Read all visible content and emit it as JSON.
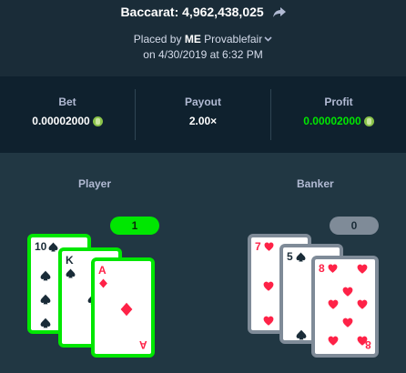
{
  "header": {
    "title": "Baccarat: 4,962,438,025",
    "placed_by_prefix": "Placed by",
    "rank_badge": "ME",
    "username": "Provablefair",
    "date_line": "on 4/30/2019 at 6:32 PM"
  },
  "stats": {
    "bet_label": "Bet",
    "bet_value": "0.00002000",
    "payout_label": "Payout",
    "payout_value": "2.00×",
    "profit_label": "Profit",
    "profit_value": "0.00002000"
  },
  "game": {
    "player_label": "Player",
    "banker_label": "Banker",
    "player_score": "1",
    "banker_score": "0",
    "player_cards": [
      {
        "rank": "10",
        "suit": "spade"
      },
      {
        "rank": "K",
        "suit": "spade"
      },
      {
        "rank": "A",
        "suit": "diamond"
      }
    ],
    "banker_cards": [
      {
        "rank": "7",
        "suit": "heart"
      },
      {
        "rank": "5",
        "suit": "spade"
      },
      {
        "rank": "8",
        "suit": "heart"
      }
    ]
  },
  "colors": {
    "win": "#00e701",
    "lose": "#7f8b98",
    "red_suit": "#fe2247",
    "black_suit": "#1a2c38"
  }
}
